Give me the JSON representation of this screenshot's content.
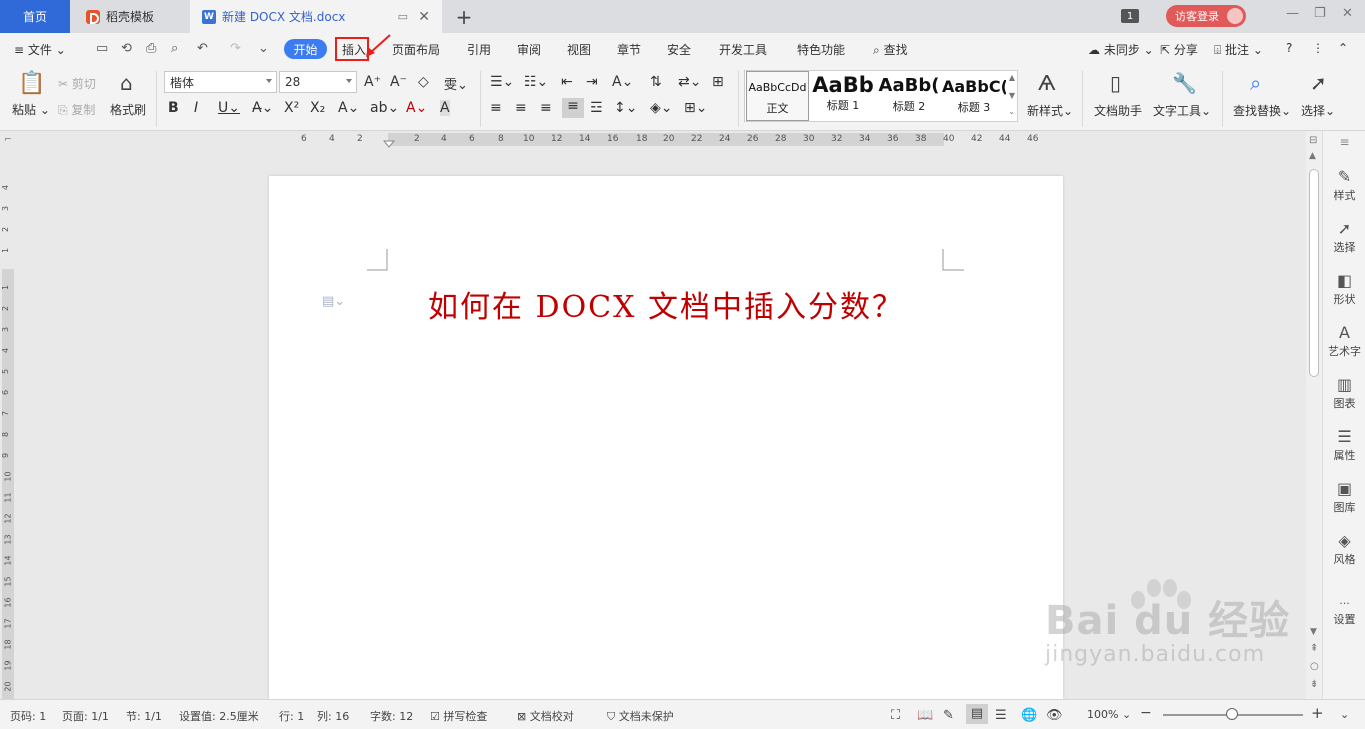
{
  "tabs": {
    "home": "首页",
    "daoke": "稻壳模板",
    "doc": "新建 DOCX 文档.docx"
  },
  "titlebar": {
    "window_count": "1",
    "login": "访客登录"
  },
  "menu": {
    "file": "文件",
    "start": "开始",
    "insert": "插入",
    "page_layout": "页面布局",
    "references": "引用",
    "review": "审阅",
    "view": "视图",
    "chapter": "章节",
    "security": "安全",
    "developer": "开发工具",
    "special": "特色功能",
    "find": "查找",
    "unsynced": "未同步",
    "share": "分享",
    "comment": "批注"
  },
  "ribbon": {
    "paste": "粘贴",
    "cut": "剪切",
    "copy": "复制",
    "format_painter": "格式刷",
    "font_name": "楷体",
    "font_size": "28",
    "styles": [
      {
        "sample": "AaBbCcDd",
        "label": "正文"
      },
      {
        "sample": "AaBb",
        "label": "标题 1"
      },
      {
        "sample": "AaBb(",
        "label": "标题 2"
      },
      {
        "sample": "AaBbC(",
        "label": "标题 3"
      }
    ],
    "new_style": "新样式",
    "doc_assistant": "文档助手",
    "text_tools": "文字工具",
    "find_replace": "查找替换",
    "select": "选择"
  },
  "ruler": {
    "numbers": [
      "6",
      "4",
      "2",
      "2",
      "4",
      "6",
      "8",
      "10",
      "12",
      "14",
      "16",
      "18",
      "20",
      "22",
      "24",
      "26",
      "28",
      "30",
      "32",
      "34",
      "36",
      "38",
      "40",
      "42",
      "44",
      "46"
    ]
  },
  "vruler": {
    "numbers": [
      "4",
      "3",
      "2",
      "1",
      "1",
      "2",
      "3",
      "4",
      "5",
      "6",
      "7",
      "8",
      "9",
      "10",
      "11",
      "12",
      "13",
      "14",
      "15",
      "16",
      "17",
      "18",
      "19",
      "20"
    ]
  },
  "document": {
    "title": "如何在 DOCX 文档中插入分数？"
  },
  "sidebar": {
    "items": [
      {
        "icon": "pen-icon",
        "glyph": "✎",
        "label": "样式"
      },
      {
        "icon": "cursor-icon",
        "glyph": "➚",
        "label": "选择"
      },
      {
        "icon": "shape-icon",
        "glyph": "◧",
        "label": "形状"
      },
      {
        "icon": "wordart-icon",
        "glyph": "A",
        "label": "艺术字"
      },
      {
        "icon": "chart-icon",
        "glyph": "▥",
        "label": "图表"
      },
      {
        "icon": "properties-icon",
        "glyph": "☰",
        "label": "属性"
      },
      {
        "icon": "image-icon",
        "glyph": "▣",
        "label": "图库"
      },
      {
        "icon": "style-theme-icon",
        "glyph": "◈",
        "label": "风格"
      },
      {
        "icon": "more-icon",
        "glyph": "···",
        "label": "设置"
      }
    ]
  },
  "status": {
    "page": "页码: 1",
    "pages": "页面: 1/1",
    "section": "节: 1/1",
    "setting": "设置值: 2.5厘米",
    "line": "行: 1",
    "column": "列: 16",
    "word_count": "字数: 12",
    "spell_check": "拼写检查",
    "proofread": "文档校对",
    "unprotected": "文档未保护",
    "zoom": "100%"
  },
  "watermark": {
    "main": "Bai du 经验",
    "sub": "jingyan.baidu.com"
  },
  "colors": {
    "accent": "#3b7cf3",
    "title_red": "#c00000",
    "highlight_red": "#e8201a",
    "login": "#e05a5a"
  }
}
